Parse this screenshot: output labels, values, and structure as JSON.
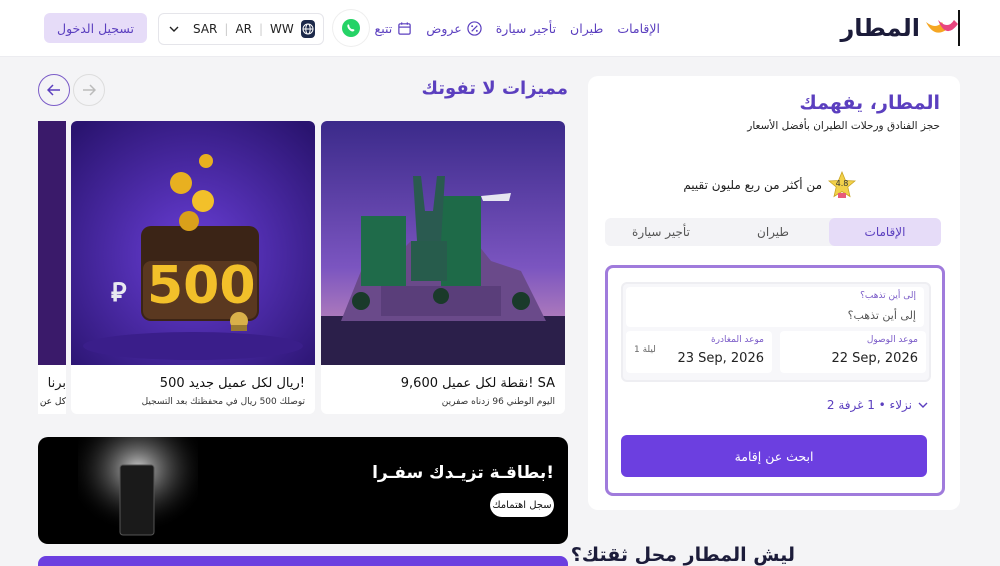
{
  "header": {
    "logo_text": "المطار",
    "nav": [
      {
        "label": "الإقامات",
        "icon": ""
      },
      {
        "label": "طيران",
        "icon": ""
      },
      {
        "label": "تأجير سيارة",
        "icon": ""
      },
      {
        "label": "عروض",
        "icon": "percent-icon"
      },
      {
        "label": "تتبع",
        "icon": "calendar-icon"
      }
    ],
    "locale": {
      "currency": "SAR",
      "language": "AR",
      "region": "WW"
    },
    "login_label": "تسجيل الدخول"
  },
  "search_panel": {
    "title": "المطار، يفهمك",
    "subtitle": "حجز الفنادق ورحلات الطيران بأفضل الأسعار",
    "rating_value": "4.8",
    "rating_text": "من أكثر من ربع مليون تقييم",
    "tabs": [
      {
        "label": "الإقامات",
        "active": true
      },
      {
        "label": "طيران",
        "active": false
      },
      {
        "label": "تأجير سيارة",
        "active": false
      }
    ],
    "destination": {
      "label": "إلى أين تذهب؟",
      "placeholder": "إلى أين تذهب؟"
    },
    "checkin": {
      "label": "موعد الوصول",
      "value": "22 Sep, 2026"
    },
    "checkout": {
      "label": "موعد المغادرة",
      "value": "23 Sep, 2026",
      "nights": "1 ليلة"
    },
    "guests": "2 نزلاء • 1 غرفة",
    "search_button": "ابحث عن إقامة"
  },
  "features": {
    "title": "مميزات لا تفوتك",
    "cards": [
      {
        "title": "9,600 نقطة لكل عميل! SA",
        "desc": "اليوم الوطني 96 زدناه صفرين"
      },
      {
        "title": "500 ريال لكل عميل جديد!",
        "desc": "توصلك 500 ريال في محفظتك بعد التسجيل"
      },
      {
        "title": "برنا",
        "desc": "كل عن"
      }
    ],
    "wallet_amount": "500",
    "banner": {
      "title": "بطاقـة تزيـدك سفـرا!",
      "button": "سجل اهتمامك"
    }
  },
  "bottom_title": "ليش المطار محل ثقتك؟",
  "colors": {
    "brand": "#5b3fbf",
    "button": "#6c3fe0",
    "active_tab": "#e6dcf8"
  }
}
